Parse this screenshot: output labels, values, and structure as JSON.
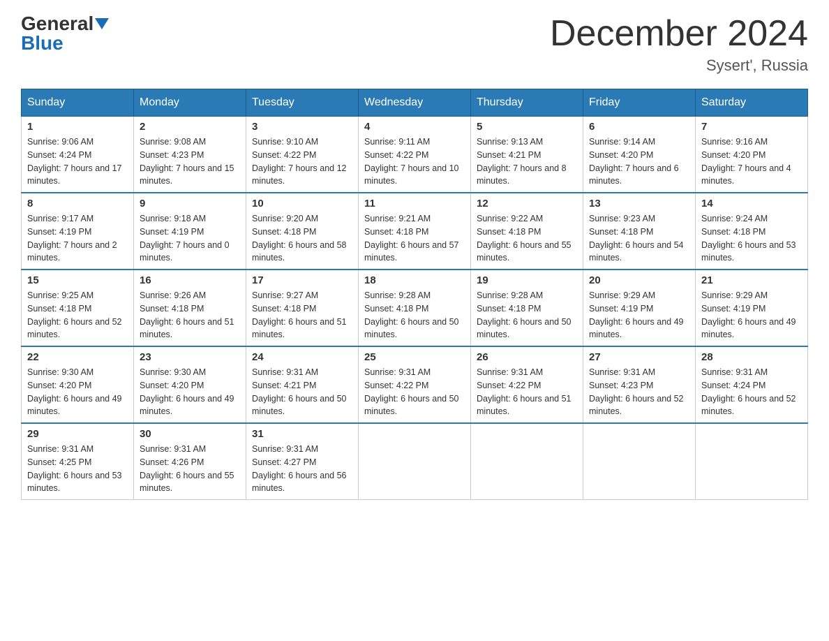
{
  "header": {
    "logo_general": "General",
    "logo_blue": "Blue",
    "title": "December 2024",
    "location": "Sysert', Russia"
  },
  "days_of_week": [
    "Sunday",
    "Monday",
    "Tuesday",
    "Wednesday",
    "Thursday",
    "Friday",
    "Saturday"
  ],
  "weeks": [
    [
      {
        "day": "1",
        "sunrise": "9:06 AM",
        "sunset": "4:24 PM",
        "daylight": "7 hours and 17 minutes."
      },
      {
        "day": "2",
        "sunrise": "9:08 AM",
        "sunset": "4:23 PM",
        "daylight": "7 hours and 15 minutes."
      },
      {
        "day": "3",
        "sunrise": "9:10 AM",
        "sunset": "4:22 PM",
        "daylight": "7 hours and 12 minutes."
      },
      {
        "day": "4",
        "sunrise": "9:11 AM",
        "sunset": "4:22 PM",
        "daylight": "7 hours and 10 minutes."
      },
      {
        "day": "5",
        "sunrise": "9:13 AM",
        "sunset": "4:21 PM",
        "daylight": "7 hours and 8 minutes."
      },
      {
        "day": "6",
        "sunrise": "9:14 AM",
        "sunset": "4:20 PM",
        "daylight": "7 hours and 6 minutes."
      },
      {
        "day": "7",
        "sunrise": "9:16 AM",
        "sunset": "4:20 PM",
        "daylight": "7 hours and 4 minutes."
      }
    ],
    [
      {
        "day": "8",
        "sunrise": "9:17 AM",
        "sunset": "4:19 PM",
        "daylight": "7 hours and 2 minutes."
      },
      {
        "day": "9",
        "sunrise": "9:18 AM",
        "sunset": "4:19 PM",
        "daylight": "7 hours and 0 minutes."
      },
      {
        "day": "10",
        "sunrise": "9:20 AM",
        "sunset": "4:18 PM",
        "daylight": "6 hours and 58 minutes."
      },
      {
        "day": "11",
        "sunrise": "9:21 AM",
        "sunset": "4:18 PM",
        "daylight": "6 hours and 57 minutes."
      },
      {
        "day": "12",
        "sunrise": "9:22 AM",
        "sunset": "4:18 PM",
        "daylight": "6 hours and 55 minutes."
      },
      {
        "day": "13",
        "sunrise": "9:23 AM",
        "sunset": "4:18 PM",
        "daylight": "6 hours and 54 minutes."
      },
      {
        "day": "14",
        "sunrise": "9:24 AM",
        "sunset": "4:18 PM",
        "daylight": "6 hours and 53 minutes."
      }
    ],
    [
      {
        "day": "15",
        "sunrise": "9:25 AM",
        "sunset": "4:18 PM",
        "daylight": "6 hours and 52 minutes."
      },
      {
        "day": "16",
        "sunrise": "9:26 AM",
        "sunset": "4:18 PM",
        "daylight": "6 hours and 51 minutes."
      },
      {
        "day": "17",
        "sunrise": "9:27 AM",
        "sunset": "4:18 PM",
        "daylight": "6 hours and 51 minutes."
      },
      {
        "day": "18",
        "sunrise": "9:28 AM",
        "sunset": "4:18 PM",
        "daylight": "6 hours and 50 minutes."
      },
      {
        "day": "19",
        "sunrise": "9:28 AM",
        "sunset": "4:18 PM",
        "daylight": "6 hours and 50 minutes."
      },
      {
        "day": "20",
        "sunrise": "9:29 AM",
        "sunset": "4:19 PM",
        "daylight": "6 hours and 49 minutes."
      },
      {
        "day": "21",
        "sunrise": "9:29 AM",
        "sunset": "4:19 PM",
        "daylight": "6 hours and 49 minutes."
      }
    ],
    [
      {
        "day": "22",
        "sunrise": "9:30 AM",
        "sunset": "4:20 PM",
        "daylight": "6 hours and 49 minutes."
      },
      {
        "day": "23",
        "sunrise": "9:30 AM",
        "sunset": "4:20 PM",
        "daylight": "6 hours and 49 minutes."
      },
      {
        "day": "24",
        "sunrise": "9:31 AM",
        "sunset": "4:21 PM",
        "daylight": "6 hours and 50 minutes."
      },
      {
        "day": "25",
        "sunrise": "9:31 AM",
        "sunset": "4:22 PM",
        "daylight": "6 hours and 50 minutes."
      },
      {
        "day": "26",
        "sunrise": "9:31 AM",
        "sunset": "4:22 PM",
        "daylight": "6 hours and 51 minutes."
      },
      {
        "day": "27",
        "sunrise": "9:31 AM",
        "sunset": "4:23 PM",
        "daylight": "6 hours and 52 minutes."
      },
      {
        "day": "28",
        "sunrise": "9:31 AM",
        "sunset": "4:24 PM",
        "daylight": "6 hours and 52 minutes."
      }
    ],
    [
      {
        "day": "29",
        "sunrise": "9:31 AM",
        "sunset": "4:25 PM",
        "daylight": "6 hours and 53 minutes."
      },
      {
        "day": "30",
        "sunrise": "9:31 AM",
        "sunset": "4:26 PM",
        "daylight": "6 hours and 55 minutes."
      },
      {
        "day": "31",
        "sunrise": "9:31 AM",
        "sunset": "4:27 PM",
        "daylight": "6 hours and 56 minutes."
      },
      null,
      null,
      null,
      null
    ]
  ]
}
